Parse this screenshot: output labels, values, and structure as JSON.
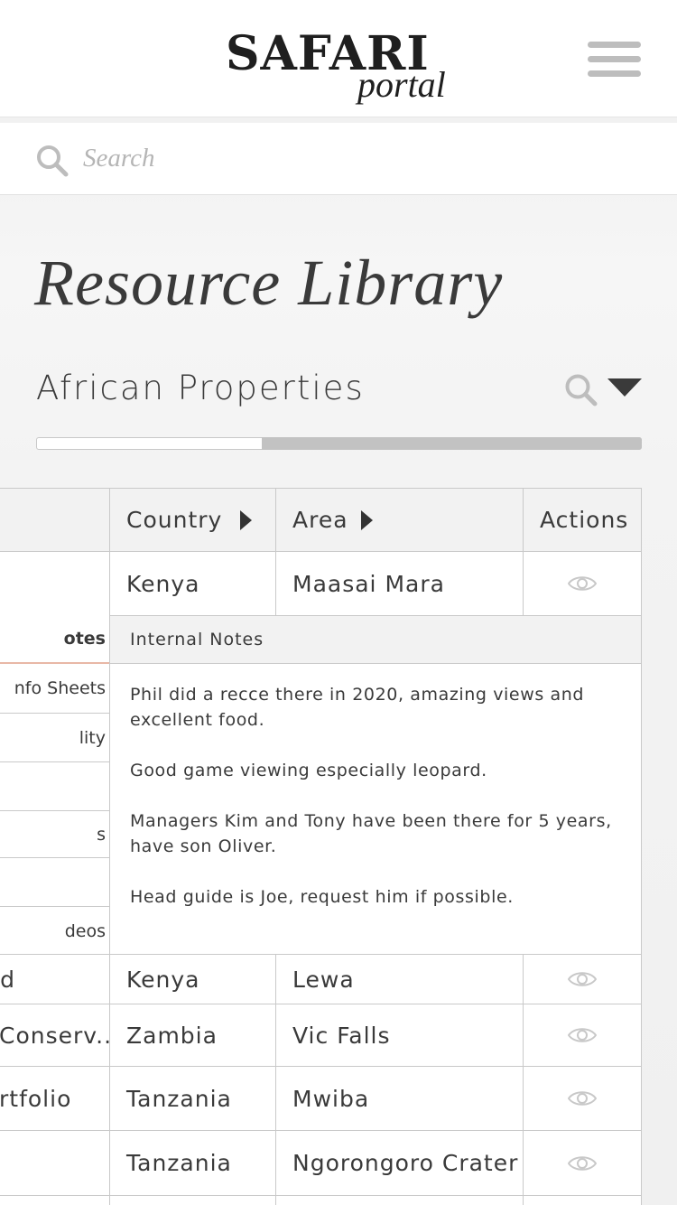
{
  "header": {
    "logo_main": "SAFARI",
    "logo_sub": "portal"
  },
  "search": {
    "placeholder": "Search",
    "value": ""
  },
  "page_title": "Resource Library",
  "section": {
    "title": "African Properties"
  },
  "scroll": {
    "position_fraction": 0.37
  },
  "table": {
    "headers": {
      "country": "Country",
      "area": "Area",
      "actions": "Actions"
    },
    "rows": [
      {
        "left_text": "",
        "country": "Kenya",
        "area": "Maasai Mara"
      },
      {
        "left_text": "nd",
        "country": "Kenya",
        "area": "Lewa"
      },
      {
        "left_text": "Conserv...",
        "country": "Zambia",
        "area": "Vic Falls"
      },
      {
        "left_text": "rtfolio",
        "country": "Tanzania",
        "area": "Mwiba"
      },
      {
        "left_text": "",
        "country": "Tanzania",
        "area": "Ngorongoro Crater"
      }
    ],
    "sub_tabs": [
      "otes",
      "nfo Sheets",
      "lity",
      "",
      "s",
      "",
      "deos"
    ],
    "notes": {
      "heading": "Internal Notes",
      "paragraphs": [
        "Phil did a recce there in 2020, amazing views and excellent food.",
        "Good game viewing especially leopard.",
        "Managers Kim and Tony have been there for 5 years, have son Oliver.",
        "Head guide is Joe, request him if possible."
      ]
    }
  },
  "colors": {
    "accent_underline": "#e8b8a6",
    "text": "#3a3a3a",
    "border": "#c9c9c9",
    "icon_grey": "#bdbdbd"
  },
  "icons": {
    "menu": "hamburger-menu-icon",
    "search": "search-icon",
    "view": "eye-icon",
    "sort": "triangle-right-icon",
    "dropdown": "caret-down-icon"
  }
}
